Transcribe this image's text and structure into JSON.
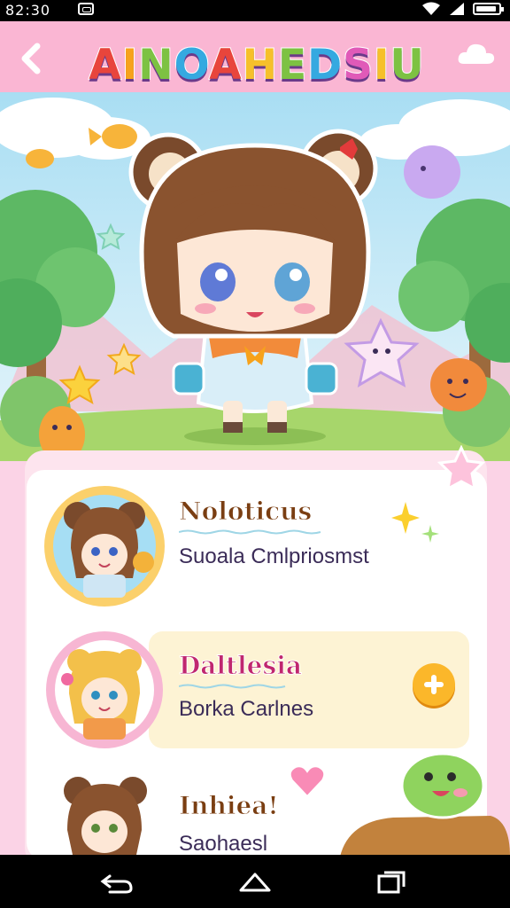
{
  "status_bar": {
    "time": "82:30"
  },
  "header": {
    "title": "AINOAHEDSIU",
    "title_colors": [
      "#e8453c",
      "#f7a21b",
      "#7dc242",
      "#35a9e0",
      "#e8453c",
      "#f6c02a",
      "#7dc242",
      "#35a9e0",
      "#e05ab8",
      "#f6c02a",
      "#7dc242"
    ]
  },
  "characters": [
    {
      "name": "Noloticus",
      "subtitle": "Suoala Cmlpriosmst",
      "name_color": "#7a3e12"
    },
    {
      "name": "Daltlesia",
      "subtitle": "Borka Carlnes",
      "name_color": "#c0276f"
    },
    {
      "name": "Inhiea!",
      "subtitle": "Saohaesl",
      "name_color": "#7a3e12"
    }
  ],
  "colors": {
    "header_bg": "#fab6d3",
    "panel_bg": "#fde4ee",
    "accent": "#fbb72a",
    "sky": "#bfe6f5",
    "grass": "#a7d66b"
  },
  "icons": [
    "back-arrow-icon",
    "cloud-icon",
    "add-icon",
    "nav-back-icon",
    "nav-home-icon",
    "nav-recents-icon",
    "wifi-icon",
    "signal-icon",
    "battery-icon",
    "message-icon"
  ]
}
